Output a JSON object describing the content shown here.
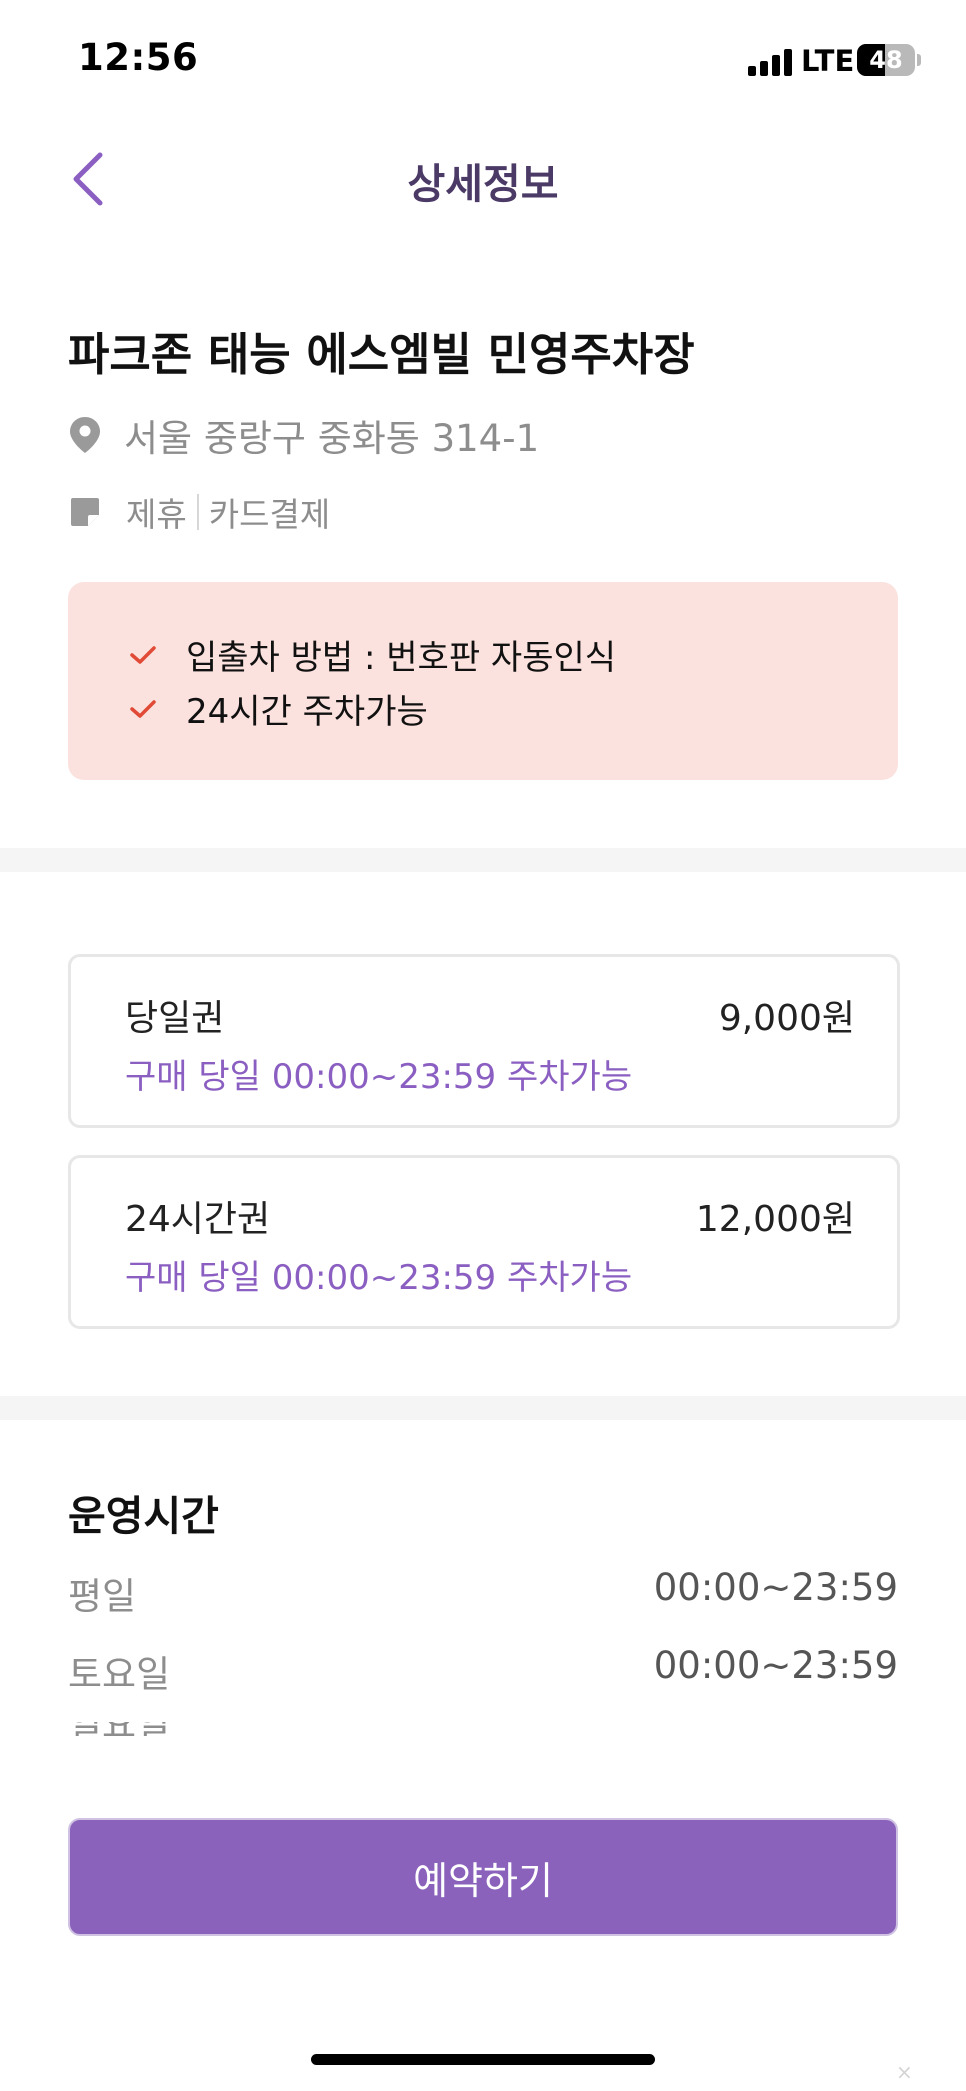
{
  "status_bar": {
    "time": "12:56",
    "network": "LTE",
    "battery": "48",
    "battery_level_percent": 48
  },
  "header": {
    "title": "상세정보",
    "back_icon": "chevron-left-icon",
    "accent_color": "#8b5fc2"
  },
  "lot": {
    "name": "파크존 태능 에스엠빌 민영주차장",
    "address_icon": "location-pin-icon",
    "address": "서울 중랑구 중화동 314-1",
    "tags_icon": "note-icon",
    "tags": [
      "제휴",
      "카드결제"
    ]
  },
  "notice": {
    "background_color": "#fbe2de",
    "check_color": "#e04a36",
    "items": [
      "입출차 방법 : 번호판 자동인식",
      "24시간 주차가능"
    ]
  },
  "tickets": [
    {
      "name": "당일권",
      "price": "9,000원",
      "description": "구매 당일 00:00~23:59 주차가능"
    },
    {
      "name": "24시간권",
      "price": "12,000원",
      "description": "구매 당일 00:00~23:59 주차가능"
    }
  ],
  "hours": {
    "title": "운영시간",
    "rows": [
      {
        "day": "평일",
        "time": "00:00~23:59"
      },
      {
        "day": "토요일",
        "time": "00:00~23:59"
      }
    ],
    "partially_hidden_row_day": "일요일"
  },
  "reserve_button": {
    "label": "예약하기",
    "color": "#8a62bc"
  }
}
